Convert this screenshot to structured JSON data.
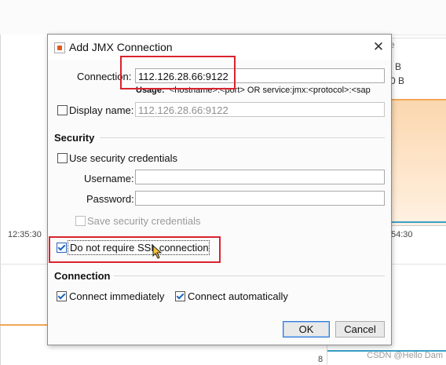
{
  "background": {
    "time_left": "12:35:30",
    "time_right": "54:30",
    "right_label_1": "B",
    "right_label_2": "0 B",
    "right_header": "e",
    "axis_label": "8",
    "watermark": "CSDN @Hello Dam",
    "colors": {
      "memory_line": "#f2a65a",
      "cpu_line": "#3aa0c8"
    }
  },
  "dialog": {
    "title": "Add JMX Connection",
    "icon": "java-app-icon",
    "close_label": "✕",
    "connection": {
      "label": "Connection:",
      "value": "112.126.28.66:9122",
      "usage_prefix": "Usage:",
      "usage_text": "<hostname>:<port> OR service:jmx:<protocol>:<sap"
    },
    "display_name": {
      "label": "Display name:",
      "checked": false,
      "value": "112.126.28.66:9122"
    },
    "security": {
      "title": "Security",
      "use_credentials_label": "Use security credentials",
      "use_credentials_checked": false,
      "username_label": "Username:",
      "username_value": "",
      "password_label": "Password:",
      "password_value": "",
      "save_credentials_label": "Save security credentials",
      "save_credentials_checked": false,
      "no_ssl_label": "Do not require SSL connection",
      "no_ssl_checked": true
    },
    "connection_section": {
      "title": "Connection",
      "connect_immediately_label": "Connect immediately",
      "connect_immediately_checked": true,
      "connect_automatically_label": "Connect automatically",
      "connect_automatically_checked": true
    },
    "buttons": {
      "ok": "OK",
      "cancel": "Cancel"
    },
    "highlight_color": "#d9232e"
  }
}
